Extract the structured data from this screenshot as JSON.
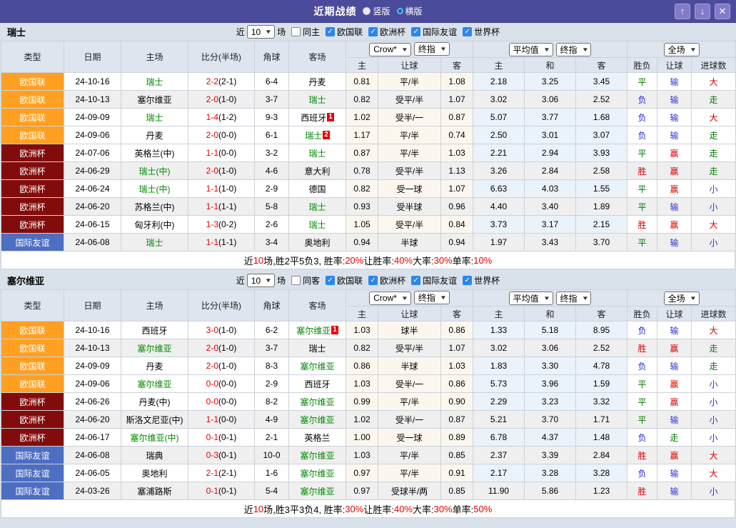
{
  "titlebar": {
    "title": "近期战绩",
    "vertical": "竖版",
    "horizontal": "横版"
  },
  "icons": {
    "check": "✓",
    "chevron_down": "▼",
    "up": "↑",
    "down": "↓",
    "close": "✕"
  },
  "colors": {
    "titlebar_bg": "#4B4B9B",
    "self_team": "#008800",
    "score_red": "#E60000",
    "type_bg": {
      "欧国联": "#FFA022",
      "欧洲杯": "#820C0C",
      "国际友谊": "#4E6EC2"
    },
    "result_text": {
      "胜": "#DD0000",
      "平": "#007A00",
      "负": "#2626CC",
      "赢": "#DD0000",
      "输": "#3333CC",
      "走": "#007A00",
      "大": "#DD0000",
      "小": "#3333CC"
    }
  },
  "filter": {
    "near": "近",
    "count": "10",
    "games": "场",
    "comps": [
      "欧国联",
      "欧洲杯",
      "国际友谊",
      "世界杯"
    ]
  },
  "selects": {
    "crown": "Crow*",
    "final": "终指",
    "average": "平均值",
    "final2": "终指",
    "scope": "全场"
  },
  "columns": {
    "type": "类型",
    "date": "日期",
    "home": "主场",
    "score": "比分(半场)",
    "corner": "角球",
    "away": "客场",
    "home_odds": "主",
    "handicap": "让球",
    "away_odds": "客",
    "avg_home": "主",
    "avg_draw": "和",
    "avg_away": "客",
    "outcome": "胜负",
    "handicap_result": "让球",
    "goals": "进球数"
  },
  "sections": [
    {
      "team": "瑞士",
      "same_label": "同主",
      "rows": [
        {
          "type": "欧国联",
          "date": "24-10-16",
          "home": "瑞士",
          "home_self": true,
          "home_badge": "",
          "score": "2-2",
          "half": "(2-1)",
          "corner": "6-4",
          "away": "丹麦",
          "away_self": false,
          "away_badge": "",
          "crown": [
            "0.81",
            "平/半",
            "1.08"
          ],
          "avg": [
            "2.18",
            "3.25",
            "3.45"
          ],
          "outcome": "平",
          "handicap_outcome": "输",
          "goals_outcome": "大",
          "shaded": false
        },
        {
          "type": "欧国联",
          "date": "24-10-13",
          "home": "塞尔维亚",
          "home_self": false,
          "home_badge": "",
          "score": "2-0",
          "half": "(1-0)",
          "corner": "3-7",
          "away": "瑞士",
          "away_self": true,
          "away_badge": "",
          "crown": [
            "0.82",
            "受平/半",
            "1.07"
          ],
          "avg": [
            "3.02",
            "3.06",
            "2.52"
          ],
          "outcome": "负",
          "handicap_outcome": "输",
          "goals_outcome": "走",
          "shaded": true
        },
        {
          "type": "欧国联",
          "date": "24-09-09",
          "home": "瑞士",
          "home_self": true,
          "home_badge": "",
          "score": "1-4",
          "half": "(1-2)",
          "corner": "9-3",
          "away": "西班牙",
          "away_self": false,
          "away_badge": "1",
          "crown": [
            "1.02",
            "受半/一",
            "0.87"
          ],
          "avg": [
            "5.07",
            "3.77",
            "1.68"
          ],
          "outcome": "负",
          "handicap_outcome": "输",
          "goals_outcome": "大",
          "shaded": false
        },
        {
          "type": "欧国联",
          "date": "24-09-06",
          "home": "丹麦",
          "home_self": false,
          "home_badge": "",
          "score": "2-0",
          "half": "(0-0)",
          "corner": "6-1",
          "away": "瑞士",
          "away_self": true,
          "away_badge": "2",
          "crown": [
            "1.17",
            "平/半",
            "0.74"
          ],
          "avg": [
            "2.50",
            "3.01",
            "3.07"
          ],
          "outcome": "负",
          "handicap_outcome": "输",
          "goals_outcome": "走",
          "shaded": false
        },
        {
          "type": "欧洲杯",
          "date": "24-07-06",
          "home": "英格兰(中)",
          "home_self": false,
          "home_badge": "",
          "score": "1-1",
          "half": "(0-0)",
          "corner": "3-2",
          "away": "瑞士",
          "away_self": true,
          "away_badge": "",
          "crown": [
            "0.87",
            "平/半",
            "1.03"
          ],
          "avg": [
            "2.21",
            "2.94",
            "3.93"
          ],
          "outcome": "平",
          "handicap_outcome": "赢",
          "goals_outcome": "走",
          "shaded": false
        },
        {
          "type": "欧洲杯",
          "date": "24-06-29",
          "home": "瑞士(中)",
          "home_self": true,
          "home_badge": "",
          "score": "2-0",
          "half": "(1-0)",
          "corner": "4-6",
          "away": "意大利",
          "away_self": false,
          "away_badge": "",
          "crown": [
            "0.78",
            "受平/半",
            "1.13"
          ],
          "avg": [
            "3.26",
            "2.84",
            "2.58"
          ],
          "outcome": "胜",
          "handicap_outcome": "赢",
          "goals_outcome": "走",
          "shaded": true
        },
        {
          "type": "欧洲杯",
          "date": "24-06-24",
          "home": "瑞士(中)",
          "home_self": true,
          "home_badge": "",
          "score": "1-1",
          "half": "(1-0)",
          "corner": "2-9",
          "away": "德国",
          "away_self": false,
          "away_badge": "",
          "crown": [
            "0.82",
            "受一球",
            "1.07"
          ],
          "avg": [
            "6.63",
            "4.03",
            "1.55"
          ],
          "outcome": "平",
          "handicap_outcome": "赢",
          "goals_outcome": "小",
          "shaded": false
        },
        {
          "type": "欧洲杯",
          "date": "24-06-20",
          "home": "苏格兰(中)",
          "home_self": false,
          "home_badge": "",
          "score": "1-1",
          "half": "(1-1)",
          "corner": "5-8",
          "away": "瑞士",
          "away_self": true,
          "away_badge": "",
          "crown": [
            "0.93",
            "受半球",
            "0.96"
          ],
          "avg": [
            "4.40",
            "3.40",
            "1.89"
          ],
          "outcome": "平",
          "handicap_outcome": "输",
          "goals_outcome": "小",
          "shaded": true
        },
        {
          "type": "欧洲杯",
          "date": "24-06-15",
          "home": "匈牙利(中)",
          "home_self": false,
          "home_badge": "",
          "score": "1-3",
          "half": "(0-2)",
          "corner": "2-6",
          "away": "瑞士",
          "away_self": true,
          "away_badge": "",
          "crown": [
            "1.05",
            "受平/半",
            "0.84"
          ],
          "avg": [
            "3.73",
            "3.17",
            "2.15"
          ],
          "outcome": "胜",
          "handicap_outcome": "赢",
          "goals_outcome": "大",
          "shaded": false
        },
        {
          "type": "国际友谊",
          "date": "24-06-08",
          "home": "瑞士",
          "home_self": true,
          "home_badge": "",
          "score": "1-1",
          "half": "(1-1)",
          "corner": "3-4",
          "away": "奥地利",
          "away_self": false,
          "away_badge": "",
          "crown": [
            "0.94",
            "半球",
            "0.94"
          ],
          "avg": [
            "1.97",
            "3.43",
            "3.70"
          ],
          "outcome": "平",
          "handicap_outcome": "输",
          "goals_outcome": "小",
          "shaded": true
        }
      ],
      "summary": [
        [
          "近",
          0
        ],
        [
          "10",
          1
        ],
        [
          "场,胜2平5负3, 胜率:",
          0
        ],
        [
          "20%",
          1
        ],
        [
          " 让胜率:",
          0
        ],
        [
          "40%",
          1
        ],
        [
          " 大率:",
          0
        ],
        [
          "30%",
          1
        ],
        [
          " 单率:",
          0
        ],
        [
          "10%",
          1
        ]
      ]
    },
    {
      "team": "塞尔维亚",
      "same_label": "同客",
      "rows": [
        {
          "type": "欧国联",
          "date": "24-10-16",
          "home": "西班牙",
          "home_self": false,
          "home_badge": "",
          "score": "3-0",
          "half": "(1-0)",
          "corner": "6-2",
          "away": "塞尔维亚",
          "away_self": true,
          "away_badge": "1",
          "crown": [
            "1.03",
            "球半",
            "0.86"
          ],
          "avg": [
            "1.33",
            "5.18",
            "8.95"
          ],
          "outcome": "负",
          "handicap_outcome": "输",
          "goals_outcome": "大",
          "shaded": false
        },
        {
          "type": "欧国联",
          "date": "24-10-13",
          "home": "塞尔维亚",
          "home_self": true,
          "home_badge": "",
          "score": "2-0",
          "half": "(1-0)",
          "corner": "3-7",
          "away": "瑞士",
          "away_self": false,
          "away_badge": "",
          "crown": [
            "0.82",
            "受平/半",
            "1.07"
          ],
          "avg": [
            "3.02",
            "3.06",
            "2.52"
          ],
          "outcome": "胜",
          "handicap_outcome": "赢",
          "goals_outcome": "走",
          "shaded": true
        },
        {
          "type": "欧国联",
          "date": "24-09-09",
          "home": "丹麦",
          "home_self": false,
          "home_badge": "",
          "score": "2-0",
          "half": "(1-0)",
          "corner": "8-3",
          "away": "塞尔维亚",
          "away_self": true,
          "away_badge": "",
          "crown": [
            "0.86",
            "半球",
            "1.03"
          ],
          "avg": [
            "1.83",
            "3.30",
            "4.78"
          ],
          "outcome": "负",
          "handicap_outcome": "输",
          "goals_outcome": "走",
          "shaded": false
        },
        {
          "type": "欧国联",
          "date": "24-09-06",
          "home": "塞尔维亚",
          "home_self": true,
          "home_badge": "",
          "score": "0-0",
          "half": "(0-0)",
          "corner": "2-9",
          "away": "西班牙",
          "away_self": false,
          "away_badge": "",
          "crown": [
            "1.03",
            "受半/一",
            "0.86"
          ],
          "avg": [
            "5.73",
            "3.96",
            "1.59"
          ],
          "outcome": "平",
          "handicap_outcome": "赢",
          "goals_outcome": "小",
          "shaded": false
        },
        {
          "type": "欧洲杯",
          "date": "24-06-26",
          "home": "丹麦(中)",
          "home_self": false,
          "home_badge": "",
          "score": "0-0",
          "half": "(0-0)",
          "corner": "8-2",
          "away": "塞尔维亚",
          "away_self": true,
          "away_badge": "",
          "crown": [
            "0.99",
            "平/半",
            "0.90"
          ],
          "avg": [
            "2.29",
            "3.23",
            "3.32"
          ],
          "outcome": "平",
          "handicap_outcome": "赢",
          "goals_outcome": "小",
          "shaded": false
        },
        {
          "type": "欧洲杯",
          "date": "24-06-20",
          "home": "斯洛文尼亚(中)",
          "home_self": false,
          "home_badge": "",
          "score": "1-1",
          "half": "(0-0)",
          "corner": "4-9",
          "away": "塞尔维亚",
          "away_self": true,
          "away_badge": "",
          "crown": [
            "1.02",
            "受半/一",
            "0.87"
          ],
          "avg": [
            "5.21",
            "3.70",
            "1.71"
          ],
          "outcome": "平",
          "handicap_outcome": "输",
          "goals_outcome": "小",
          "shaded": true
        },
        {
          "type": "欧洲杯",
          "date": "24-06-17",
          "home": "塞尔维亚(中)",
          "home_self": true,
          "home_badge": "",
          "score": "0-1",
          "half": "(0-1)",
          "corner": "2-1",
          "away": "英格兰",
          "away_self": false,
          "away_badge": "",
          "crown": [
            "1.00",
            "受一球",
            "0.89"
          ],
          "avg": [
            "6.78",
            "4.37",
            "1.48"
          ],
          "outcome": "负",
          "handicap_outcome": "走",
          "goals_outcome": "小",
          "shaded": false
        },
        {
          "type": "国际友谊",
          "date": "24-06-08",
          "home": "瑞典",
          "home_self": false,
          "home_badge": "",
          "score": "0-3",
          "half": "(0-1)",
          "corner": "10-0",
          "away": "塞尔维亚",
          "away_self": true,
          "away_badge": "",
          "crown": [
            "1.03",
            "平/半",
            "0.85"
          ],
          "avg": [
            "2.37",
            "3.39",
            "2.84"
          ],
          "outcome": "胜",
          "handicap_outcome": "赢",
          "goals_outcome": "大",
          "shaded": true
        },
        {
          "type": "国际友谊",
          "date": "24-06-05",
          "home": "奥地利",
          "home_self": false,
          "home_badge": "",
          "score": "2-1",
          "half": "(2-1)",
          "corner": "1-6",
          "away": "塞尔维亚",
          "away_self": true,
          "away_badge": "",
          "crown": [
            "0.97",
            "平/半",
            "0.91"
          ],
          "avg": [
            "2.17",
            "3.28",
            "3.28"
          ],
          "outcome": "负",
          "handicap_outcome": "输",
          "goals_outcome": "大",
          "shaded": false
        },
        {
          "type": "国际友谊",
          "date": "24-03-26",
          "home": "塞浦路斯",
          "home_self": false,
          "home_badge": "",
          "score": "0-1",
          "half": "(0-1)",
          "corner": "5-4",
          "away": "塞尔维亚",
          "away_self": true,
          "away_badge": "",
          "crown": [
            "0.97",
            "受球半/两",
            "0.85"
          ],
          "avg": [
            "11.90",
            "5.86",
            "1.23"
          ],
          "outcome": "胜",
          "handicap_outcome": "输",
          "goals_outcome": "小",
          "shaded": true
        }
      ],
      "summary": [
        [
          "近",
          0
        ],
        [
          "10",
          1
        ],
        [
          "场,胜3平3负4, 胜率:",
          0
        ],
        [
          "30%",
          1
        ],
        [
          " 让胜率:",
          0
        ],
        [
          "40%",
          1
        ],
        [
          " 大率:",
          0
        ],
        [
          "30%",
          1
        ],
        [
          " 单率:",
          0
        ],
        [
          "50%",
          1
        ]
      ]
    }
  ]
}
